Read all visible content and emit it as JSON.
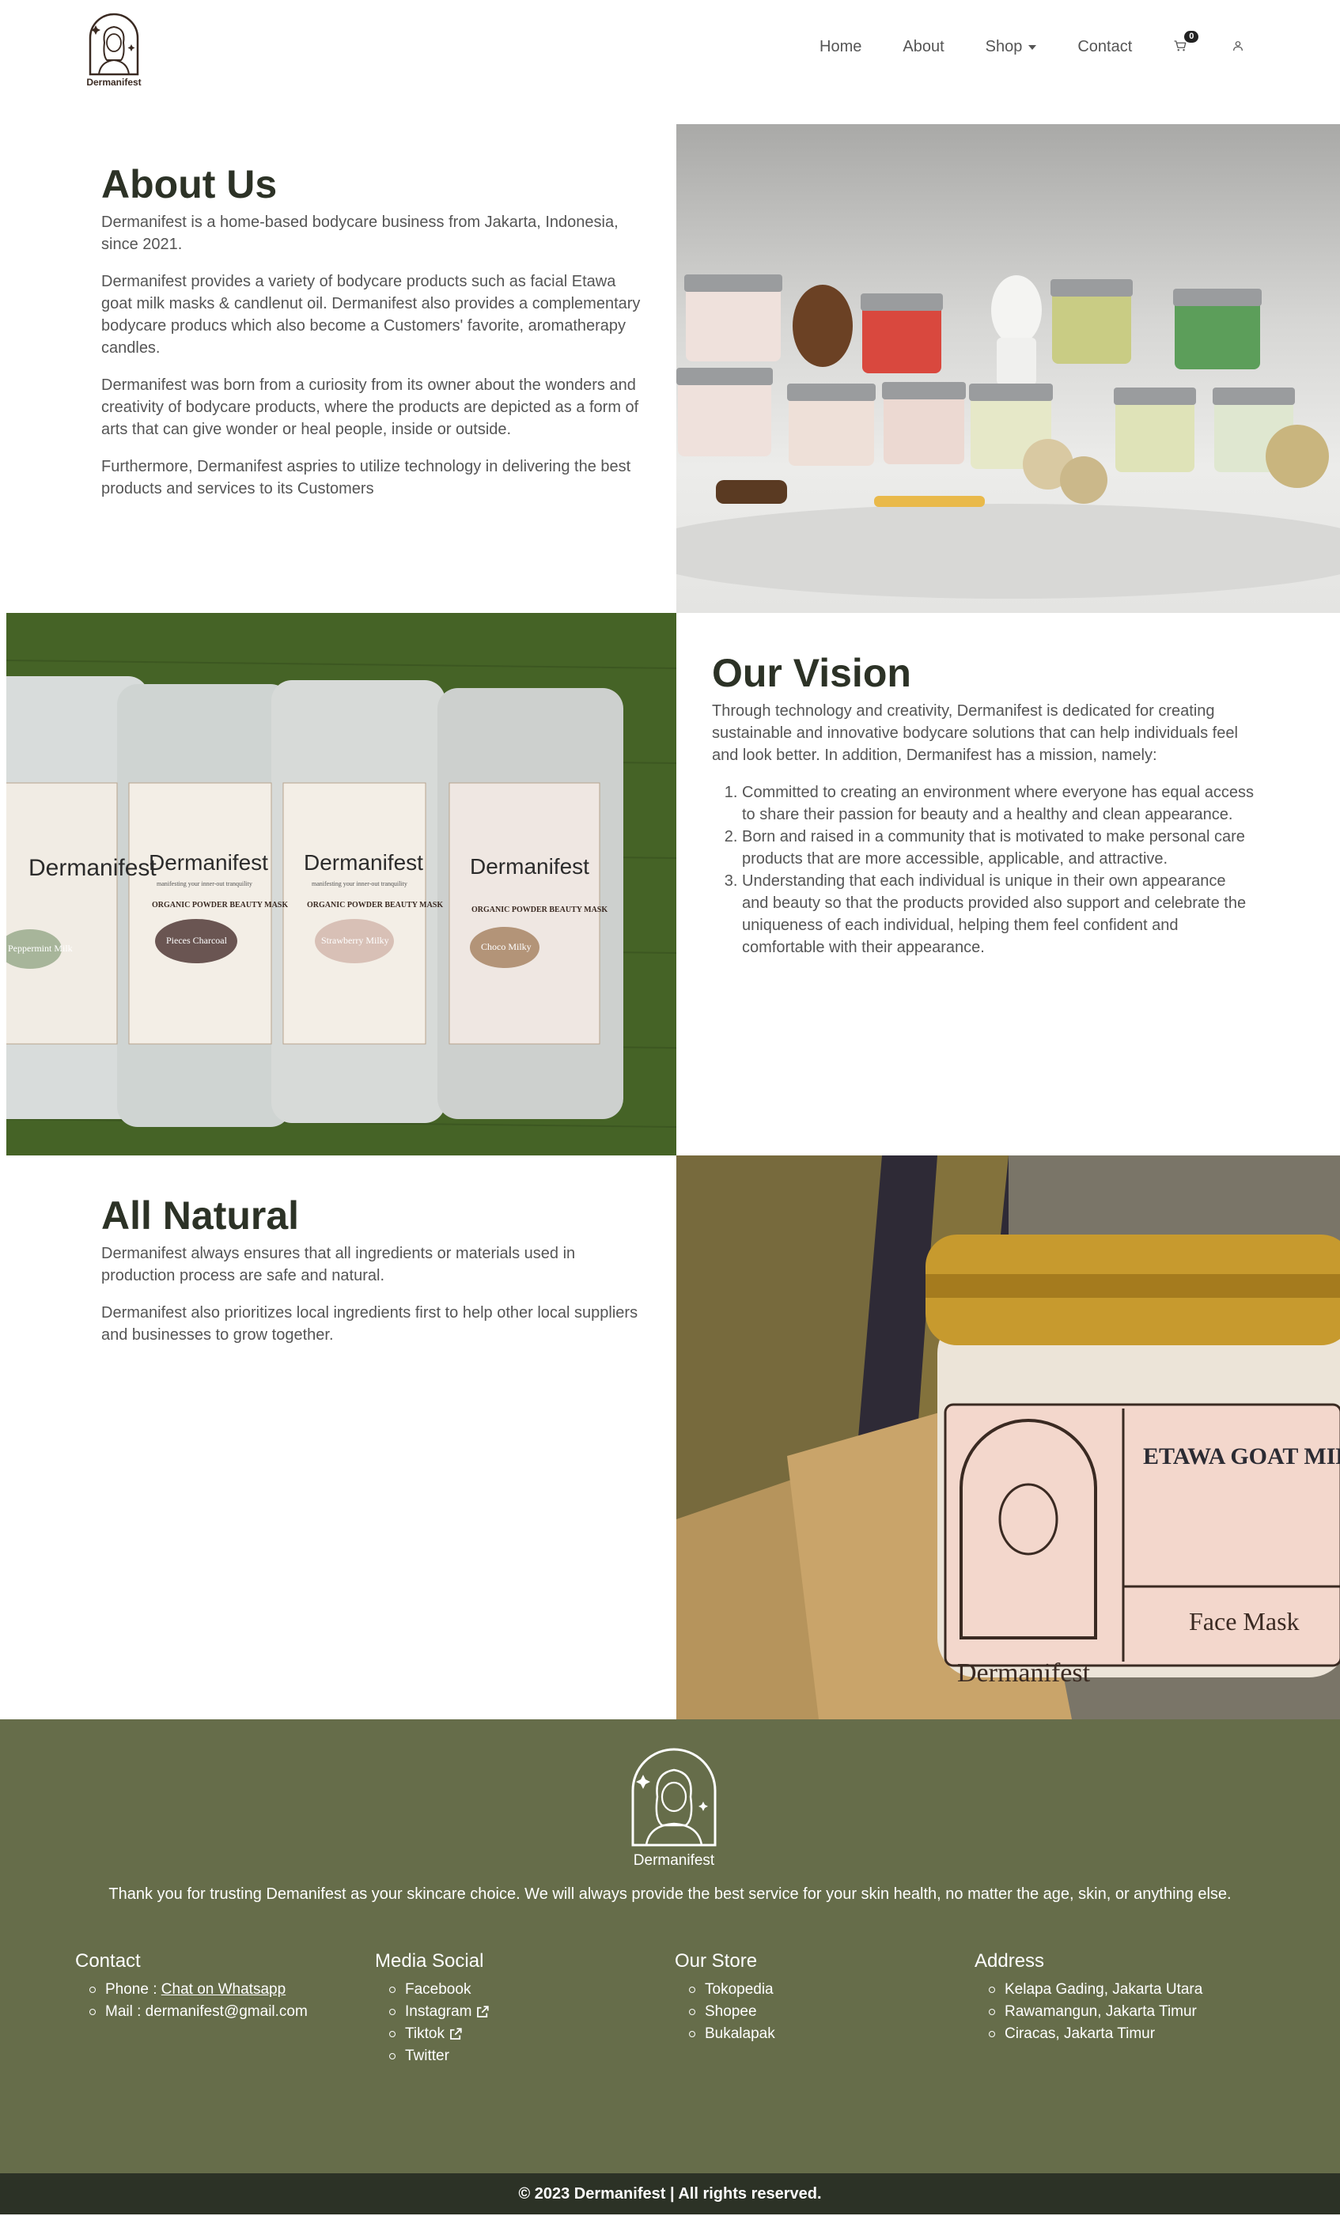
{
  "brand": {
    "name": "Dermanifest"
  },
  "nav": {
    "home": "Home",
    "about": "About",
    "shop": "Shop",
    "contact": "Contact",
    "cart_count": "0"
  },
  "about": {
    "title": "About Us",
    "paragraphs": [
      "Dermanifest is a home-based bodycare business from Jakarta, Indonesia, since 2021.",
      "Dermanifest provides a variety of bodycare products such as facial Etawa goat milk masks & candlenut oil. Dermanifest also provides a complementary bodycare producs which also become a Customers' favorite, aromatherapy candles.",
      "Dermanifest was born from a curiosity from its owner about the wonders and creativity of bodycare products, where the products are depicted as a form of arts that can give wonder or heal people, inside or outside.",
      "Furthermore, Dermanifest aspries to utilize technology in delivering the best products and services to its Customers"
    ]
  },
  "vision": {
    "title": "Our Vision",
    "intro": "Through technology and creativity, Dermanifest is dedicated for creating sustainable and innovative bodycare solutions that can help individuals feel and look better. In addition, Dermanifest has a mission, namely:",
    "items": [
      "Committed to creating an environment where everyone has equal access to share their passion for beauty and a healthy and clean appearance.",
      "Born and raised in a community that is motivated to make personal care products that are more accessible, applicable, and attractive.",
      "Understanding that each individual is unique in their own appearance and beauty so that the products provided also support and celebrate the uniqueness of each individual, helping them feel confident and comfortable with their appearance."
    ]
  },
  "natural": {
    "title": "All Natural",
    "paragraphs": [
      "Dermanifest always ensures that all ingredients or materials used in production process are safe and natural.",
      "Dermanifest also prioritizes local ingredients first to help other local suppliers and businesses to grow together."
    ]
  },
  "images": {
    "packets": {
      "brand": "Dermanifest",
      "tagline": "manifesting your inner-out tranquility",
      "type": "ORGANIC POWDER BEAUTY MASK",
      "flavors": [
        "Peppermint Milk",
        "Pieces Charcoal",
        "Strawberry Milky",
        "Choco Milky"
      ]
    },
    "jar": {
      "brand": "Dermanifest",
      "title": "ETAWA GOAT MILK MASK",
      "subtitle": "Face Mask"
    }
  },
  "footer": {
    "brand": "Dermanifest",
    "thanks": "Thank you for trusting Demanifest as your skincare choice. We will always provide the best service for your skin health, no matter the age, skin, or anything else.",
    "contact": {
      "title": "Contact",
      "phone_label": "Phone : ",
      "phone_link": "Chat on Whatsapp",
      "mail": "Mail : dermanifest@gmail.com"
    },
    "social": {
      "title": "Media Social",
      "items": [
        "Facebook",
        "Instagram",
        "Tiktok",
        "Twitter"
      ]
    },
    "store": {
      "title": "Our Store",
      "items": [
        "Tokopedia",
        "Shopee",
        "Bukalapak"
      ]
    },
    "address": {
      "title": "Address",
      "items": [
        "Kelapa Gading, Jakarta Utara",
        "Rawamangun, Jakarta Timur",
        "Ciracas, Jakarta Timur"
      ]
    },
    "copyright": "© 2023 Dermanifest | All rights reserved."
  },
  "colors": {
    "heading": "#2c3226",
    "footer_bg": "#666d4a",
    "bottom_bar": "#2c3226"
  }
}
